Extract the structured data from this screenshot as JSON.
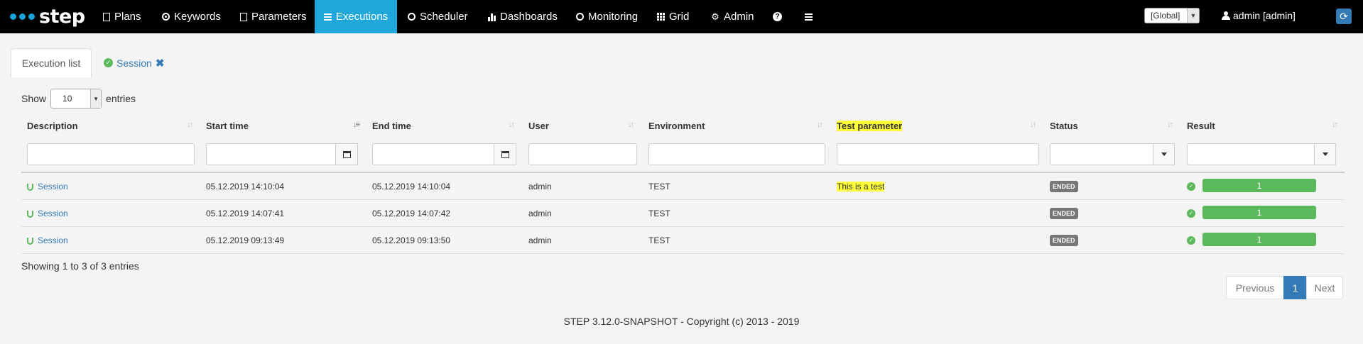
{
  "brand": "step",
  "nav": {
    "items": [
      {
        "label": "Plans",
        "icon": "file-icon"
      },
      {
        "label": "Keywords",
        "icon": "target-icon"
      },
      {
        "label": "Parameters",
        "icon": "list-icon"
      },
      {
        "label": "Executions",
        "icon": "tasks-icon"
      },
      {
        "label": "Scheduler",
        "icon": "clock-icon"
      },
      {
        "label": "Dashboards",
        "icon": "bar-chart-icon"
      },
      {
        "label": "Monitoring",
        "icon": "dashboard-icon"
      },
      {
        "label": "Grid",
        "icon": "grid-icon"
      },
      {
        "label": "Admin",
        "icon": "gear-icon"
      }
    ],
    "active": "Executions",
    "context": "[Global]",
    "user": "admin [admin]"
  },
  "tabs": {
    "list": "Execution list",
    "session": "Session"
  },
  "length": {
    "show": "Show",
    "value": "10",
    "entries": "entries"
  },
  "table": {
    "columns": [
      "Description",
      "Start time",
      "End time",
      "User",
      "Environment",
      "Test parameter",
      "Status",
      "Result"
    ],
    "rows": [
      {
        "description": "Session",
        "start": "05.12.2019 14:10:04",
        "end": "05.12.2019 14:10:04",
        "user": "admin",
        "env": "TEST",
        "param": "This is a test",
        "status": "ENDED",
        "result": "1"
      },
      {
        "description": "Session",
        "start": "05.12.2019 14:07:41",
        "end": "05.12.2019 14:07:42",
        "user": "admin",
        "env": "TEST",
        "param": "",
        "status": "ENDED",
        "result": "1"
      },
      {
        "description": "Session",
        "start": "05.12.2019 09:13:49",
        "end": "05.12.2019 09:13:50",
        "user": "admin",
        "env": "TEST",
        "param": "",
        "status": "ENDED",
        "result": "1"
      }
    ]
  },
  "info": "Showing 1 to 3 of 3 entries",
  "pagination": {
    "previous": "Previous",
    "current": "1",
    "next": "Next"
  },
  "footer": "STEP 3.12.0-SNAPSHOT - Copyright (c) 2013 - 2019",
  "colors": {
    "navbar": "#000000",
    "active": "#1fa8d9",
    "success": "#5cb85c",
    "link": "#337ab7",
    "highlight": "#ffff3a"
  }
}
